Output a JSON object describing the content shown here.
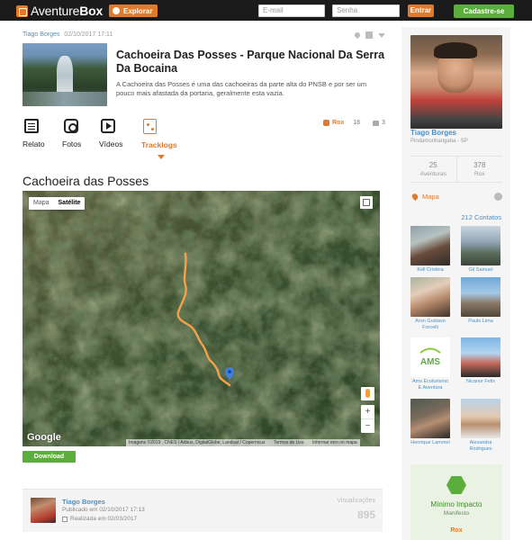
{
  "brand": {
    "name": "AventureBox",
    "name_a": "Aventure",
    "name_b": "Box"
  },
  "topbar": {
    "explorar": "Explorar",
    "email_placeholder": "E-mail",
    "senha_placeholder": "Senha",
    "entrar": "Entrar",
    "cadastre": "Cadastre-se"
  },
  "post": {
    "author": "Tiago Borges",
    "date": "02/10/2017 17:11",
    "title": "Cachoeira Das Posses - Parque Nacional Da Serra Da Bocaina",
    "description": "A Cachoeira das Posses é uma das cachoeiras da parte alta do PNSB e por ser um pouco mais afastada da portaria, geralmente esta vazia."
  },
  "tabs": [
    {
      "label": "Relato",
      "icon": "document-icon"
    },
    {
      "label": "Fotos",
      "icon": "camera-icon"
    },
    {
      "label": "Vídeos",
      "icon": "play-icon"
    },
    {
      "label": "Tracklogs",
      "icon": "tracklog-icon"
    }
  ],
  "stats": {
    "rox_label": "Rox",
    "rox_count": "18",
    "comments": "3"
  },
  "map": {
    "title": "Cachoeira das Posses",
    "toggle_map": "Mapa",
    "toggle_sat": "Satélite",
    "google": "Google",
    "attribution": "Imagens ©2019 , CNES / Airbus, DigitalGlobe, Landsat / Copernicus",
    "terms": "Termos de Uso",
    "report": "Informar erro no mapa",
    "zoom_in": "+",
    "zoom_out": "−"
  },
  "download": "Download",
  "footer": {
    "name": "Tiago Borges",
    "published": "Publicado em 02/10/2017 17:13",
    "realized": "Realizada em 02/03/2017",
    "views_label": "Visualizações",
    "views": "895"
  },
  "profile": {
    "name": "Tiago Borges",
    "city": "Pindamonhangaba - SP",
    "aventuras_count": "25",
    "aventuras_label": "Aventuras",
    "rox_count": "378",
    "rox_label": "Rox",
    "mapa": "Mapa",
    "contatos": "212 Contatos"
  },
  "contacts": [
    {
      "name": "Kell Cristina"
    },
    {
      "name": "Gil Samuel"
    },
    {
      "name": "Aron Gustavo Forcelli"
    },
    {
      "name": "Paulo Lima"
    },
    {
      "name": "Ams Ecoturismo E Aventura"
    },
    {
      "name": "Nicanor Felix"
    },
    {
      "name": "Henrique Lammel"
    },
    {
      "name": "Alexandra Rodrigues"
    }
  ],
  "minimo": {
    "title": "Mínimo Impacto",
    "sub": "Manifesto",
    "rox": "Rox"
  },
  "ams_logo_text": "AMS",
  "colors": {
    "orange": "#e07a2c",
    "green": "#5cae3c",
    "blue": "#4a8fc3"
  }
}
